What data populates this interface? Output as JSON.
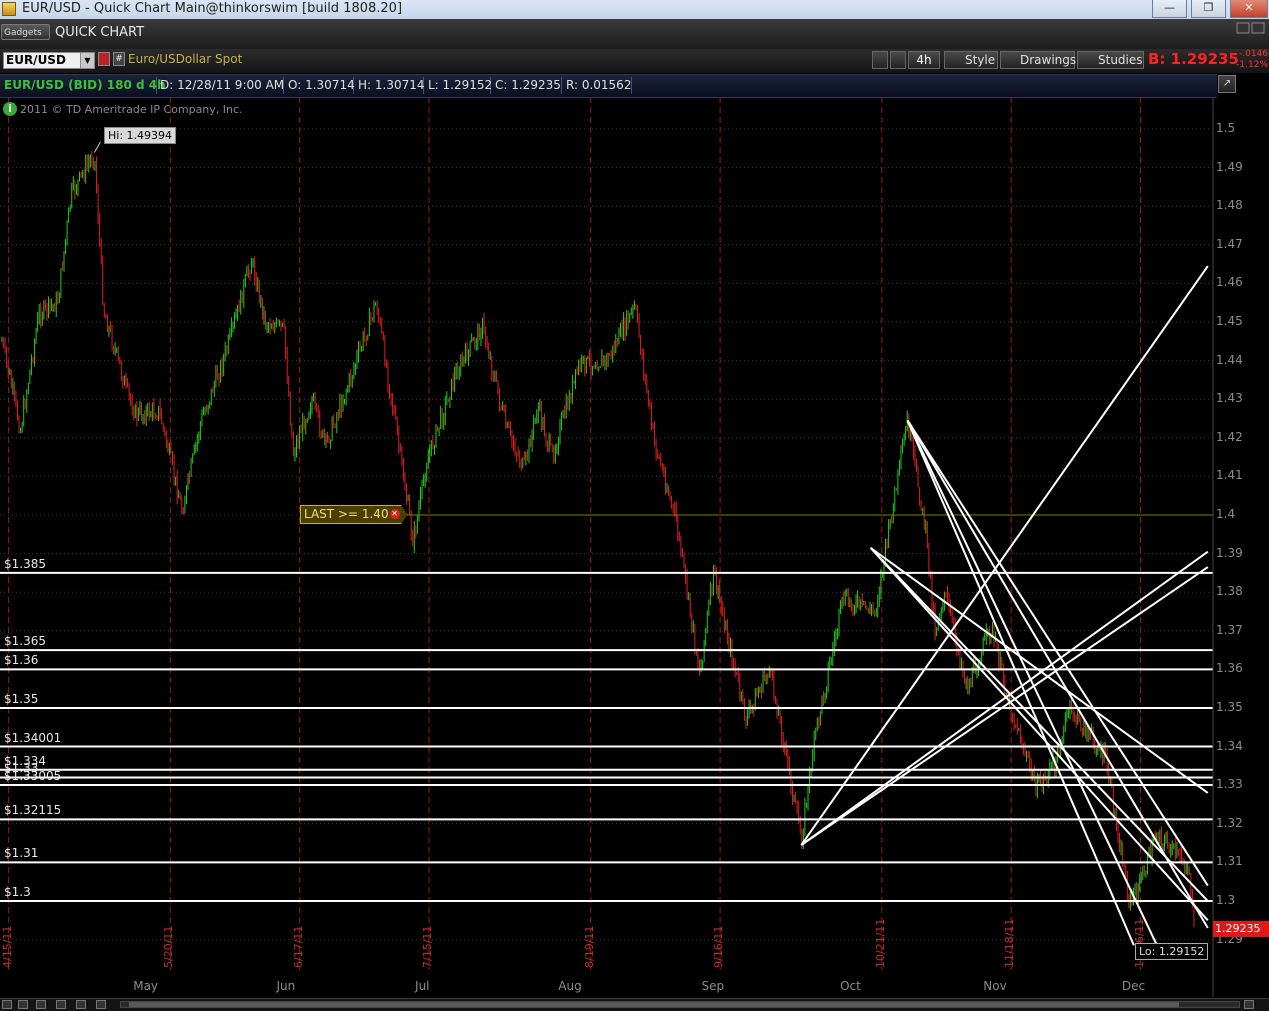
{
  "window": {
    "title": "EUR/USD - Quick Chart Main@thinkorswim [build 1808.20]",
    "minimize_glyph": "—",
    "maximize_glyph": "❐",
    "close_glyph": "✕"
  },
  "gadget_bar": {
    "gadgets_label": "Gadgets",
    "panel_title": "QUICK CHART"
  },
  "toolbar": {
    "symbol": "EUR/USD",
    "description": "Euro/USDollar Spot",
    "aggregation": "4h",
    "style_label": "Style",
    "drawings_label": "Drawings",
    "studies_label": "Studies",
    "bid_price": "B: 1.29235",
    "net_change": "-.0146",
    "percent_change": "-1.12%"
  },
  "info_bar": {
    "symbol": "EUR/USD (BID) 180 d 4h",
    "date": "D: 12/28/11 9:00 AM",
    "open": "O: 1.30714",
    "high": "H: 1.30714",
    "low": "L: 1.29152",
    "close": "C: 1.29235",
    "range": "R: 0.01562"
  },
  "chart": {
    "copyright": "2011 © TD Ameritrade IP Company, Inc.",
    "hi_label": "Hi: 1.49394",
    "lo_label": "Lo: 1.29152",
    "alert_label": "LAST >= 1.40",
    "current_price": "1.29235",
    "colors": {
      "up": "#22cc22",
      "down": "#e02020",
      "level_line": "#ffffff",
      "alert_line": "#8a7a00",
      "date_line": "#a01818",
      "background": "#000000"
    }
  },
  "chart_data": {
    "type": "candlestick",
    "title": "EUR/USD (BID) 180 d 4h",
    "ylim": [
      1.289,
      1.505
    ],
    "price_ticks": [
      "1.5",
      "1.49",
      "1.48",
      "1.47",
      "1.46",
      "1.45",
      "1.44",
      "1.43",
      "1.42",
      "1.41",
      "1.4",
      "1.39",
      "1.38",
      "1.37",
      "1.36",
      "1.35",
      "1.34",
      "1.33",
      "1.32",
      "1.31",
      "1.3",
      "1.29"
    ],
    "months": [
      "May",
      "Jun",
      "Jul",
      "Aug",
      "Sep",
      "Oct",
      "Nov",
      "Dec"
    ],
    "date_markers": [
      "4/15/11",
      "5/20/11",
      "6/17/11",
      "7/15/11",
      "8/19/11",
      "9/16/11",
      "10/21/11",
      "11/18/11",
      "12/16/11"
    ],
    "price_path": [
      {
        "date": "2011-04-14",
        "price": 1.445
      },
      {
        "date": "2011-04-18",
        "price": 1.422
      },
      {
        "date": "2011-04-22",
        "price": 1.452
      },
      {
        "date": "2011-04-26",
        "price": 1.455
      },
      {
        "date": "2011-04-29",
        "price": 1.483
      },
      {
        "date": "2011-05-04",
        "price": 1.4939
      },
      {
        "date": "2011-05-06",
        "price": 1.453
      },
      {
        "date": "2011-05-11",
        "price": 1.432
      },
      {
        "date": "2011-05-13",
        "price": 1.426
      },
      {
        "date": "2011-05-18",
        "price": 1.427
      },
      {
        "date": "2011-05-23",
        "price": 1.401
      },
      {
        "date": "2011-05-27",
        "price": 1.424
      },
      {
        "date": "2011-06-02",
        "price": 1.444
      },
      {
        "date": "2011-06-07",
        "price": 1.466
      },
      {
        "date": "2011-06-10",
        "price": 1.45
      },
      {
        "date": "2011-06-14",
        "price": 1.448
      },
      {
        "date": "2011-06-16",
        "price": 1.416
      },
      {
        "date": "2011-06-20",
        "price": 1.43
      },
      {
        "date": "2011-06-23",
        "price": 1.418
      },
      {
        "date": "2011-06-28",
        "price": 1.434
      },
      {
        "date": "2011-07-04",
        "price": 1.455
      },
      {
        "date": "2011-07-08",
        "price": 1.425
      },
      {
        "date": "2011-07-12",
        "price": 1.393
      },
      {
        "date": "2011-07-15",
        "price": 1.414
      },
      {
        "date": "2011-07-21",
        "price": 1.436
      },
      {
        "date": "2011-07-27",
        "price": 1.449
      },
      {
        "date": "2011-08-01",
        "price": 1.423
      },
      {
        "date": "2011-08-05",
        "price": 1.412
      },
      {
        "date": "2011-08-08",
        "price": 1.428
      },
      {
        "date": "2011-08-11",
        "price": 1.415
      },
      {
        "date": "2011-08-17",
        "price": 1.439
      },
      {
        "date": "2011-08-23",
        "price": 1.44
      },
      {
        "date": "2011-08-29",
        "price": 1.454
      },
      {
        "date": "2011-09-02",
        "price": 1.42
      },
      {
        "date": "2011-09-07",
        "price": 1.398
      },
      {
        "date": "2011-09-12",
        "price": 1.359
      },
      {
        "date": "2011-09-15",
        "price": 1.385
      },
      {
        "date": "2011-09-22",
        "price": 1.347
      },
      {
        "date": "2011-09-27",
        "price": 1.36
      },
      {
        "date": "2011-09-29",
        "price": 1.349
      },
      {
        "date": "2011-10-04",
        "price": 1.316
      },
      {
        "date": "2011-10-07",
        "price": 1.343
      },
      {
        "date": "2011-10-13",
        "price": 1.378
      },
      {
        "date": "2011-10-20",
        "price": 1.375
      },
      {
        "date": "2011-10-27",
        "price": 1.4245
      },
      {
        "date": "2011-10-31",
        "price": 1.395
      },
      {
        "date": "2011-11-02",
        "price": 1.37
      },
      {
        "date": "2011-11-04",
        "price": 1.38
      },
      {
        "date": "2011-11-09",
        "price": 1.355
      },
      {
        "date": "2011-11-14",
        "price": 1.371
      },
      {
        "date": "2011-11-18",
        "price": 1.351
      },
      {
        "date": "2011-11-24",
        "price": 1.329
      },
      {
        "date": "2011-11-28",
        "price": 1.336
      },
      {
        "date": "2011-12-01",
        "price": 1.35
      },
      {
        "date": "2011-12-07",
        "price": 1.34
      },
      {
        "date": "2011-12-09",
        "price": 1.336
      },
      {
        "date": "2011-12-14",
        "price": 1.3
      },
      {
        "date": "2011-12-16",
        "price": 1.303
      },
      {
        "date": "2011-12-20",
        "price": 1.318
      },
      {
        "date": "2011-12-27",
        "price": 1.308
      },
      {
        "date": "2011-12-28",
        "price": 1.29235
      }
    ],
    "horizontal_levels": [
      {
        "label": "$1.385",
        "price": 1.385
      },
      {
        "label": "$1.365",
        "price": 1.365
      },
      {
        "label": "$1.36",
        "price": 1.36
      },
      {
        "label": "$1.35",
        "price": 1.35
      },
      {
        "label": "$1.34001",
        "price": 1.34001
      },
      {
        "label": "$1.334",
        "price": 1.334
      },
      {
        "label": "$1.33",
        "price": 1.332
      },
      {
        "label": "$1.33005",
        "price": 1.33005
      },
      {
        "label": "$1.32115",
        "price": 1.32115
      },
      {
        "label": "$1.31",
        "price": 1.31
      },
      {
        "label": "$1.3",
        "price": 1.3
      }
    ],
    "alert_level": 1.4,
    "trend_lines": [
      {
        "from": {
          "date": "2011-10-04",
          "price": 1.3145
        },
        "to": {
          "date": "2011-12-31",
          "price": 1.4645
        }
      },
      {
        "from": {
          "date": "2011-10-04",
          "price": 1.3145
        },
        "to": {
          "date": "2011-12-31",
          "price": 1.3865
        }
      },
      {
        "from": {
          "date": "2011-10-04",
          "price": 1.3145
        },
        "to": {
          "date": "2011-12-31",
          "price": 1.3905
        }
      },
      {
        "from": {
          "date": "2011-10-27",
          "price": 1.4245
        },
        "to": {
          "date": "2011-12-31",
          "price": 1.304
        }
      },
      {
        "from": {
          "date": "2011-10-27",
          "price": 1.4245
        },
        "to": {
          "date": "2011-12-31",
          "price": 1.293
        }
      },
      {
        "from": {
          "date": "2011-10-27",
          "price": 1.4245
        },
        "to": {
          "date": "2011-12-20",
          "price": 1.2885
        }
      },
      {
        "from": {
          "date": "2011-10-27",
          "price": 1.4245
        },
        "to": {
          "date": "2011-12-15",
          "price": 1.2885
        }
      },
      {
        "from": {
          "date": "2011-10-19",
          "price": 1.3915
        },
        "to": {
          "date": "2011-12-31",
          "price": 1.328
        }
      },
      {
        "from": {
          "date": "2011-10-19",
          "price": 1.3915
        },
        "to": {
          "date": "2011-12-31",
          "price": 1.295
        }
      },
      {
        "from": {
          "date": "2011-10-19",
          "price": 1.3915
        },
        "to": {
          "date": "2011-12-31",
          "price": 1.3
        }
      }
    ]
  }
}
